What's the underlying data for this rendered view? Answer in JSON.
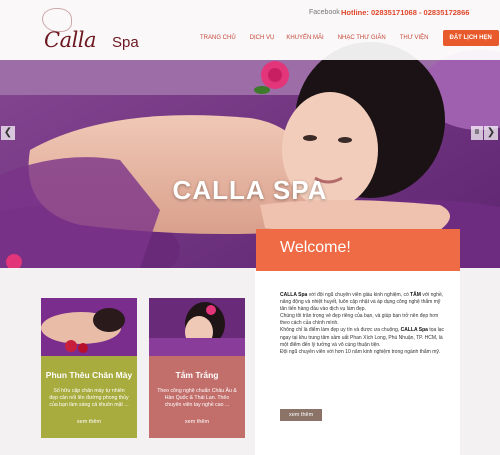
{
  "header": {
    "logo_script": "Calla",
    "logo_spa": "Spa",
    "facebook_label": "Facebook",
    "hotline": "Hotline: 02835171068 - 02835172866",
    "nav": [
      "TRANG CHỦ",
      "DỊCH VỤ",
      "KHUYẾN MÃI",
      "NHẠC THƯ GIÃN",
      "THƯ VIỆN"
    ],
    "book_button": "ĐẶT LỊCH HẸN"
  },
  "hero": {
    "title": "CALLA SPA",
    "prev_arrow": "❮",
    "next_arrow": "❯",
    "pause": "II"
  },
  "cards": [
    {
      "title": "Phun Thêu Chân Mày",
      "description": "Số hữu cặp chân mày tự nhiên đẹp cân nối lên đường phong thủy của bạn làm sáng cả khuôn mặt ...",
      "more": "xem thêm"
    },
    {
      "title": "Tắm Trắng",
      "description": "Theo công nghệ chuẩn Châu Âu & Hàn Quốc & Thái Lan. Thêo chuyên viên tay nghề cao ...",
      "more": "xem thêm"
    }
  ],
  "welcome": {
    "title": "Welcome!",
    "p1_brand": "CALLA Spa",
    "p1_a": " với đội ngũ chuyên viên giàu kinh nghiệm, có ",
    "p1_tam": "TÂM",
    "p1_b": " với nghề, năng động và nhiệt huyết, luôn cập nhật và áp dụng công nghệ thẩm mỹ tân tiến hàng đầu vào dịch vụ làm đẹp.",
    "p2": "Chúng tôi trân trọng vẻ đẹp riêng của bạn, và giúp bạn trở nên đẹp hơn theo cách của chính mình.",
    "p3_a": "Không chỉ là điểm làm đẹp uy tín và được ưa chuộng, ",
    "p3_brand": "CALLA Spa",
    "p3_b": " tọa lạc ngay tại khu trung tâm sầm uất Phan Xích Long, Phú Nhuận, TP. HCM, là một điểm đến lý tưởng và vô cùng thuận tiện.",
    "p4": "Đội ngũ chuyên viên với hơn 10 năm kinh nghiệm trong ngành thẩm mỹ.",
    "more_button": "xem thêm"
  },
  "colors": {
    "brand": "#6d1820",
    "accent": "#e85a2b",
    "card_1": "#a8ab3d",
    "card_2": "#c26e6a",
    "welcome_head": "#ef6b45"
  }
}
